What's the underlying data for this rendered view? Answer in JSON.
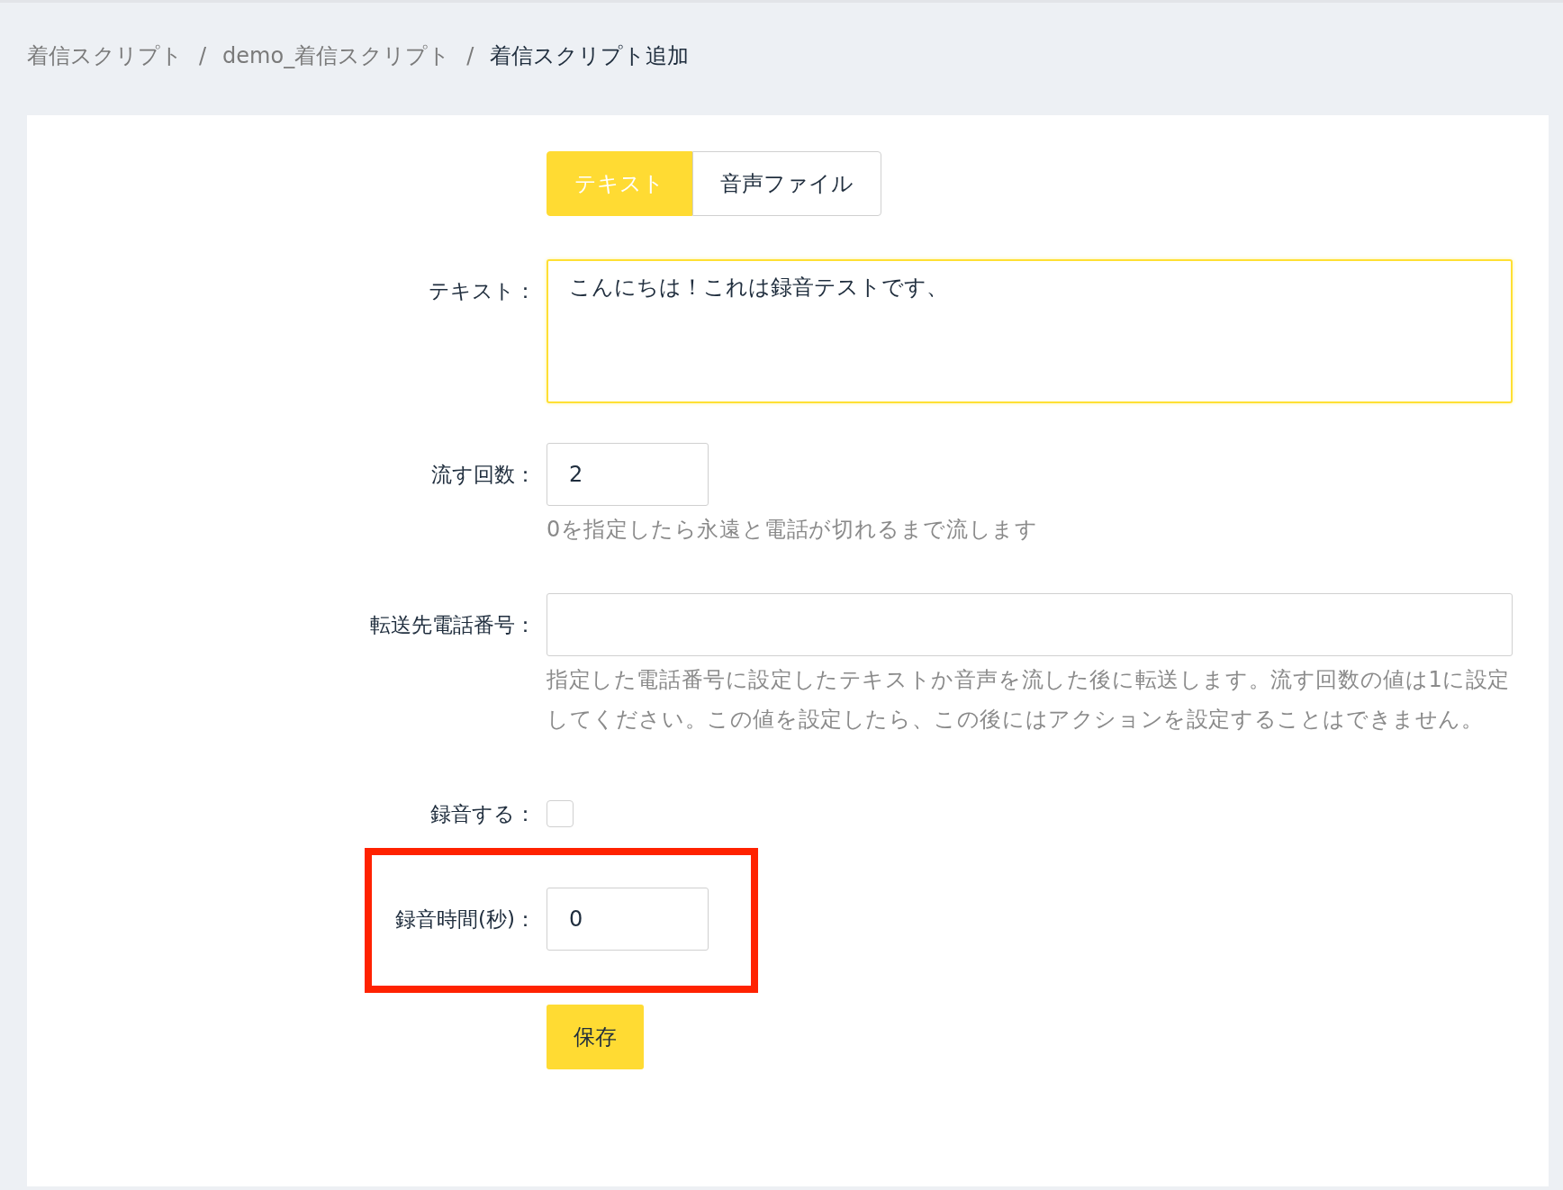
{
  "breadcrumb": [
    {
      "label": "着信スクリプト",
      "current": false
    },
    {
      "label": "demo_着信スクリプト",
      "current": false
    },
    {
      "label": "着信スクリプト追加",
      "current": true
    }
  ],
  "separator": "/",
  "tabs": [
    {
      "label": "テキスト",
      "selected": true
    },
    {
      "label": "音声ファイル",
      "selected": false
    }
  ],
  "fields": [
    {
      "kind": "textarea",
      "label": "テキスト：",
      "value": "こんにちは！これは録音テストです、",
      "focused": true
    },
    {
      "kind": "number",
      "label": "流す回数：",
      "value": "2",
      "help": "0を指定したら永遠と電話が切れるまで流します"
    },
    {
      "kind": "wide",
      "label": "転送先電話番号：",
      "help": "指定した電話番号に設定したテキストか音声を流した後に転送します。流す回数の値は1に設定してください。この値を設定したら、この後にはアクションを設定することはできません。"
    },
    {
      "kind": "checkbox",
      "label": "録音する：",
      "checked": false
    },
    {
      "kind": "number",
      "label": "録音時間(秒)：",
      "value": "0",
      "highlighted": true
    }
  ],
  "save_button": "保存"
}
